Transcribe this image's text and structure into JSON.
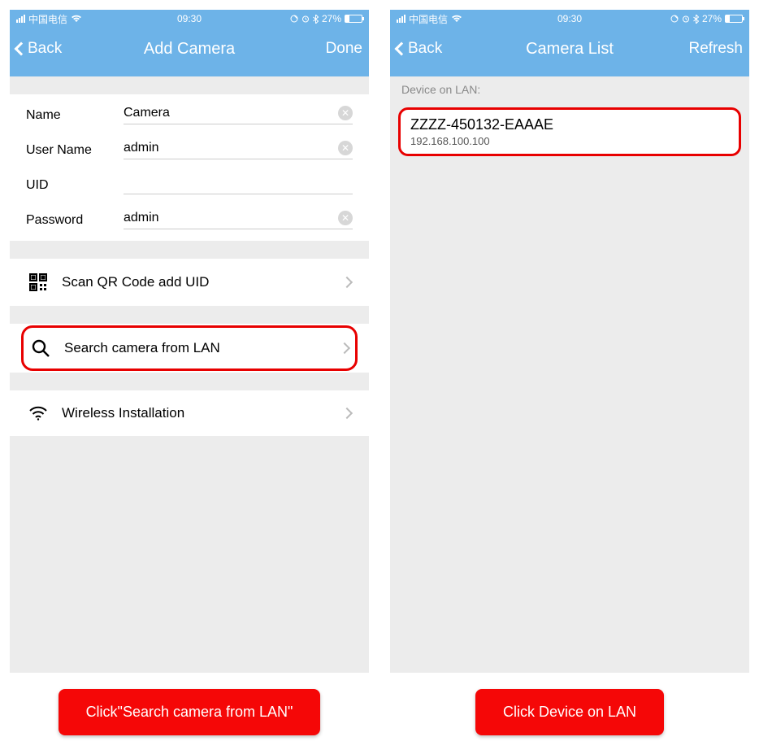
{
  "status": {
    "carrier": "中国电信",
    "time": "09:30",
    "battery_pct": "27%"
  },
  "left": {
    "nav": {
      "back": "Back",
      "title": "Add Camera",
      "action": "Done"
    },
    "form": {
      "name_label": "Name",
      "name_value": "Camera",
      "user_label": "User Name",
      "user_value": "admin",
      "uid_label": "UID",
      "uid_value": "",
      "pass_label": "Password",
      "pass_value": "admin"
    },
    "actions": {
      "scan": "Scan QR Code add UID",
      "search": "Search camera from LAN",
      "wireless": "Wireless Installation"
    }
  },
  "right": {
    "nav": {
      "back": "Back",
      "title": "Camera List",
      "action": "Refresh"
    },
    "section_title": "Device on LAN:",
    "device": {
      "id": "ZZZZ-450132-EAAAE",
      "ip": "192.168.100.100"
    }
  },
  "captions": {
    "left": "Click\"Search camera from LAN\"",
    "right": "Click Device on LAN"
  }
}
